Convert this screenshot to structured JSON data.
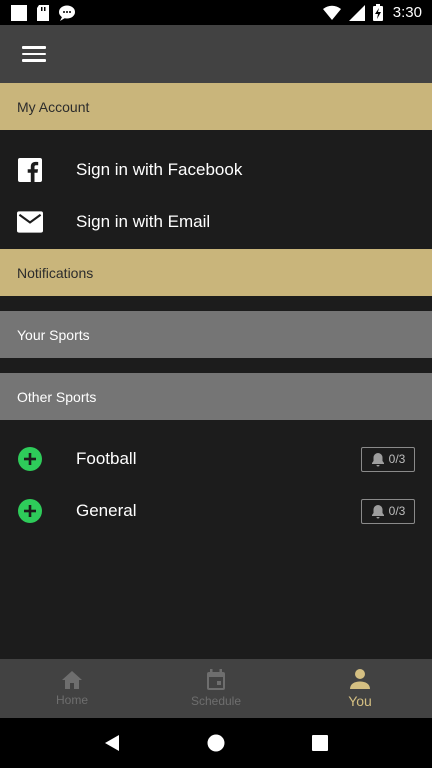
{
  "status_bar": {
    "time": "3:30",
    "icons_left": [
      "notification-square-icon",
      "sd-card-icon",
      "message-icon"
    ],
    "icons_right": [
      "wifi-icon",
      "signal-icon",
      "battery-charging-icon"
    ]
  },
  "app_bar": {
    "menu_icon": "hamburger-menu-icon"
  },
  "sections": {
    "my_account": "My Account",
    "notifications": "Notifications",
    "your_sports": "Your Sports",
    "other_sports": "Other Sports"
  },
  "account": {
    "facebook_label": "Sign in with Facebook",
    "email_label": "Sign in with Email"
  },
  "other_sports": [
    {
      "name": "Football",
      "alerts": "0/3"
    },
    {
      "name": "General",
      "alerts": "0/3"
    }
  ],
  "bottom_nav": {
    "home": "Home",
    "schedule": "Schedule",
    "you": "You",
    "active": "you"
  },
  "colors": {
    "gold_header": "#c9b57b",
    "grey_header": "#757575",
    "add_green": "#2ecc5a",
    "active_tab": "#d4bf82"
  }
}
